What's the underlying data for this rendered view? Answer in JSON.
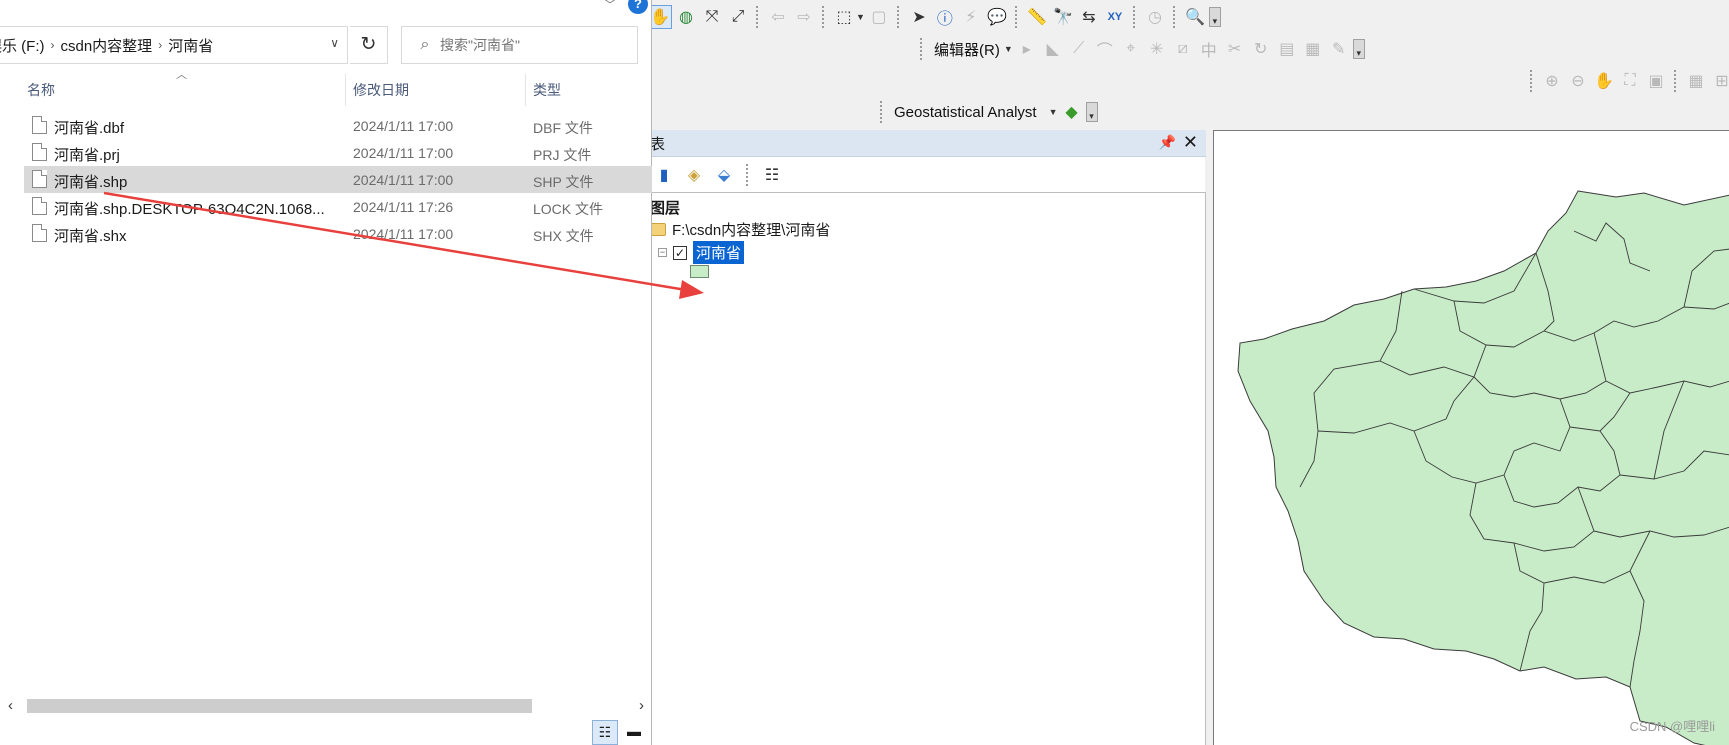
{
  "explorer": {
    "breadcrumb": [
      "娱乐 (F:)",
      "csdn内容整理",
      "河南省"
    ],
    "search_placeholder": "搜索\"河南省\"",
    "columns": {
      "name": "名称",
      "date": "修改日期",
      "type": "类型"
    },
    "files": [
      {
        "name": "河南省.dbf",
        "date": "2024/1/11 17:00",
        "type": "DBF 文件"
      },
      {
        "name": "河南省.prj",
        "date": "2024/1/11 17:00",
        "type": "PRJ 文件"
      },
      {
        "name": "河南省.shp",
        "date": "2024/1/11 17:00",
        "type": "SHP 文件",
        "selected": true
      },
      {
        "name": "河南省.shp.DESKTOP-63O4C2N.1068...",
        "date": "2024/1/11 17:26",
        "type": "LOCK 文件"
      },
      {
        "name": "河南省.shx",
        "date": "2024/1/11 17:00",
        "type": "SHX 文件"
      }
    ]
  },
  "arcmap": {
    "editor_label": "编辑器(R)",
    "geostat_label": "Geostatistical Analyst",
    "toc": {
      "title": "表",
      "root_label": "图层",
      "folder_path": "F:\\csdn内容整理\\河南省",
      "layer_name": "河南省",
      "layer_checked": true
    },
    "watermark": "CSDN @哩哩li"
  },
  "colors": {
    "selection": "#0a64d2",
    "polygon_fill": "#c8ecc8",
    "arrow": "#e8403c"
  },
  "icons": {
    "toolbar_row1": [
      "zoom-icon",
      "pan-icon",
      "full-extent-icon",
      "fixed-zoom-in-icon",
      "fixed-zoom-out-icon",
      "back-icon",
      "forward-icon",
      "select-features-icon",
      "clear-selection-icon",
      "select-elements-icon",
      "identify-icon",
      "hyperlink-icon",
      "html-popup-icon",
      "measure-icon",
      "find-icon",
      "find-route-icon",
      "goto-xy-icon",
      "time-slider-icon",
      "create-viewer-icon"
    ],
    "toolbar_row2": [
      "edit-tool-icon",
      "sketch-tool-icon",
      "straight-segment-icon",
      "end-point-arc-icon",
      "construct-points-icon",
      "split-icon",
      "reshape-icon",
      "midpoint-icon",
      "cut-polygons-icon",
      "rotate-icon",
      "attributes-icon",
      "sketch-properties-icon",
      "create-features-icon"
    ],
    "toolbar_row3": [
      "zoom-in-layout-icon",
      "zoom-out-layout-icon",
      "pan-layout-icon",
      "full-page-icon",
      "zoom-100-icon",
      "toggle-draft-icon",
      "focus-data-frame-icon"
    ]
  }
}
